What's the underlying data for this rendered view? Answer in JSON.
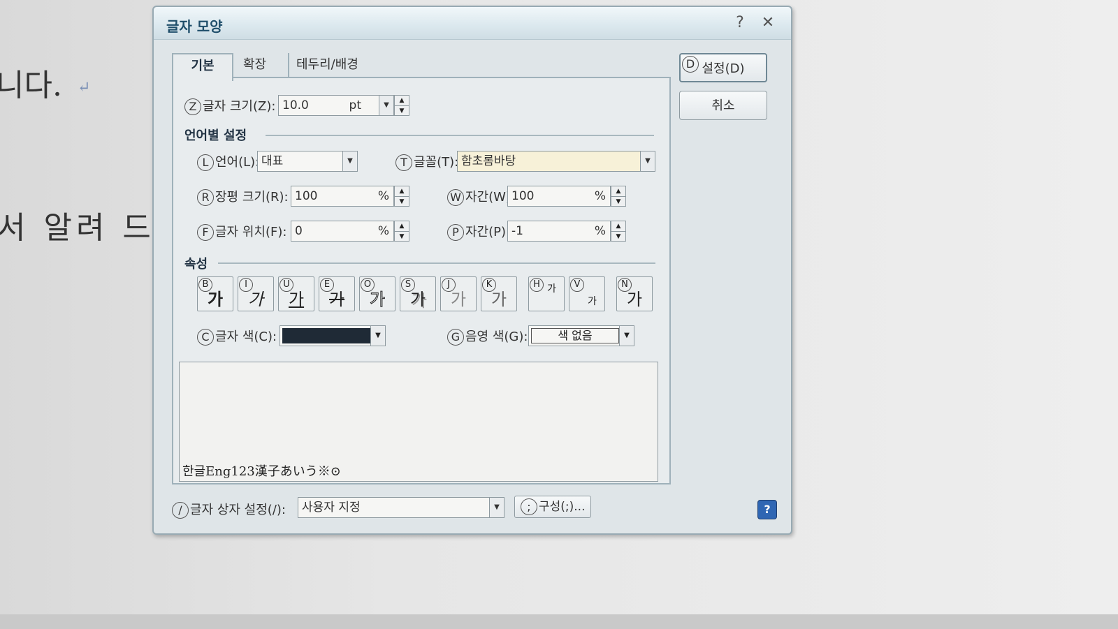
{
  "document": {
    "line1": "니다.",
    "line1_mark": "↵",
    "line2": "서 알려 드"
  },
  "dialog": {
    "title": "글자 모양",
    "help_glyph": "?",
    "close_glyph": "✕",
    "tabs": [
      "기본",
      "확장",
      "테두리/배경"
    ],
    "size": {
      "mnemonic": "Z",
      "label": "글자 크기(Z):",
      "value": "10.0",
      "unit": "pt"
    },
    "lang_section": "언어별 설정",
    "language": {
      "mnemonic": "L",
      "label": "언어(L):",
      "value": "대표"
    },
    "font": {
      "mnemonic": "T",
      "label": "글꼴(T):",
      "value": "함초롬바탕"
    },
    "ratio": {
      "mnemonic": "R",
      "label": "장평 크기(R):",
      "value": "100",
      "unit": "%"
    },
    "spacing": {
      "mnemonic": "W",
      "label": "자간(W):",
      "value": "100",
      "unit": "%"
    },
    "position": {
      "mnemonic": "F",
      "label": "글자 위치(F):",
      "value": "0",
      "unit": "%"
    },
    "pspacing": {
      "mnemonic": "P",
      "label": "자간(P):",
      "value": "-1",
      "unit": "%"
    },
    "attr_section": "속성",
    "attrs": [
      {
        "key": "B",
        "glyph": "가"
      },
      {
        "key": "I",
        "glyph": "가"
      },
      {
        "key": "U",
        "glyph": "가"
      },
      {
        "key": "E",
        "glyph": "가"
      },
      {
        "key": "O",
        "glyph": "가"
      },
      {
        "key": "S",
        "glyph": "가"
      },
      {
        "key": "J",
        "glyph": "가"
      },
      {
        "key": "K",
        "glyph": "가"
      },
      {
        "key": "H",
        "glyph": "가"
      },
      {
        "key": "V",
        "glyph": "가"
      },
      {
        "key": "N",
        "glyph": "가"
      }
    ],
    "text_color": {
      "mnemonic": "C",
      "label": "글자 색(C):",
      "value": "#1f2a36"
    },
    "shade_color": {
      "mnemonic": "G",
      "label": "음영 색(G):",
      "value": "색 없음"
    },
    "preview_text": "한글Eng123漢子あいう※⊙",
    "ok_mnemonic": "D",
    "ok": "설정(D)",
    "cancel": "취소",
    "box_mnemonic": "/",
    "box_label": "글자 상자 설정(/):",
    "box_value": "사용자 지정",
    "box_btn_mnemonic": ";",
    "box_btn": "구성(;)...",
    "help_badge": "?"
  }
}
